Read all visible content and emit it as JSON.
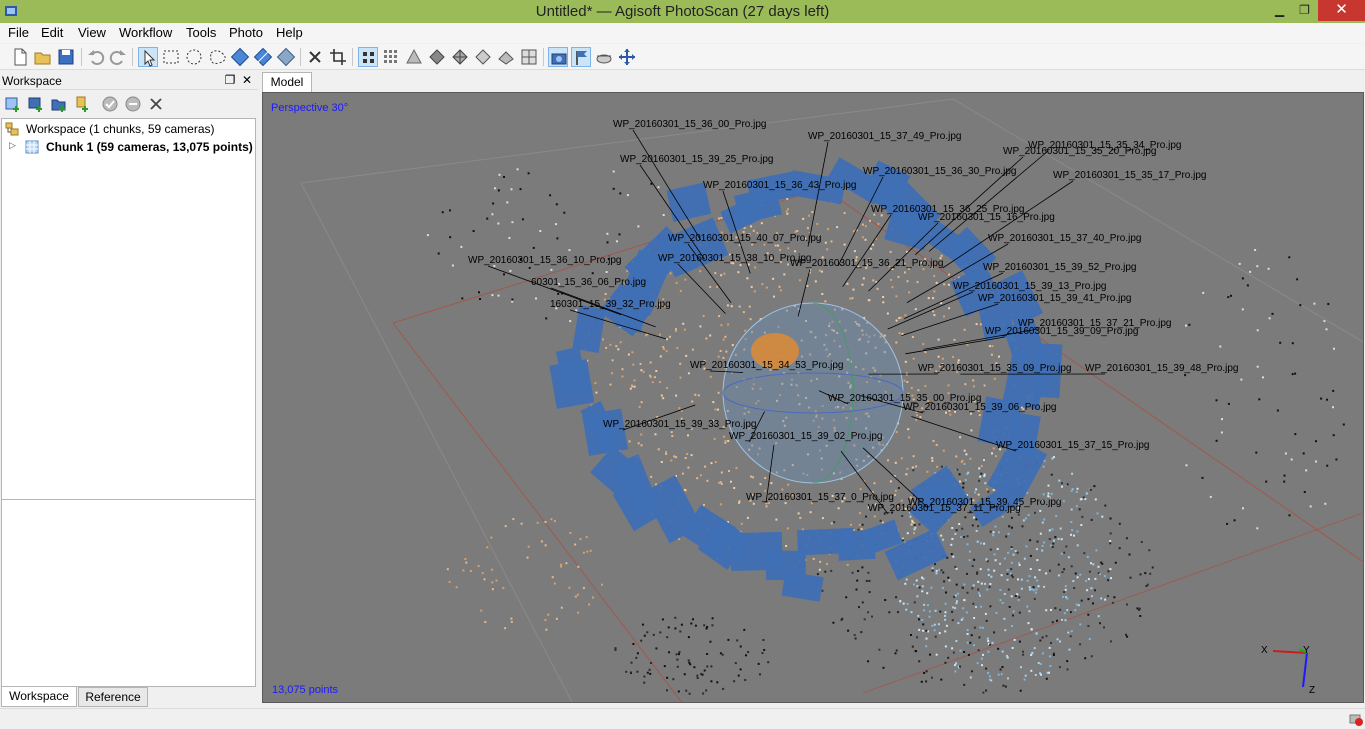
{
  "window": {
    "title": "Untitled* — Agisoft PhotoScan (27 days left)",
    "minimize_glyph": "▁",
    "maximize_glyph": "❐",
    "close_glyph": "✕"
  },
  "menu": [
    "File",
    "Edit",
    "View",
    "Workflow",
    "Tools",
    "Photo",
    "Help"
  ],
  "toolbar_icons": [
    "new-icon",
    "open-icon",
    "save-icon",
    "undo-icon",
    "redo-icon",
    "select-pointer-icon",
    "rectangle-select-icon",
    "circle-select-icon",
    "free-form-select-icon",
    "rotate-object-icon",
    "move-object-icon",
    "scale-object-icon",
    "delete-selection-icon",
    "crop-selection-icon",
    "point-cloud-icon",
    "dense-cloud-icon",
    "shaded-icon",
    "solid-icon",
    "wireframe-icon",
    "textured-icon",
    "tiled-model-icon",
    "show-cameras-icon",
    "show-markers-icon",
    "show-region-icon",
    "reset-view-icon"
  ],
  "workspace": {
    "header": "Workspace",
    "float_glyph": "❐",
    "close_glyph": "✕",
    "toolbar_icons": [
      "add-chunk-icon",
      "add-photos-icon",
      "add-folder-icon",
      "import-icon",
      "enable-icon",
      "disable-icon",
      "remove-icon"
    ],
    "tree": {
      "root_label": "Workspace (1 chunks, 59 cameras)",
      "chunk_label": "Chunk 1 (59 cameras, 13,075 points)",
      "expander_glyph": "▷"
    },
    "tabs": [
      "Workspace",
      "Reference"
    ]
  },
  "model": {
    "tab": "Model",
    "perspective_label": "Perspective 30°",
    "points_label": "13,075 points",
    "axes": {
      "x": "X",
      "y": "Y",
      "z": "Z"
    },
    "colors": {
      "background": "#7b7b7b",
      "camera": "#3f6fb5",
      "label": "#000000",
      "overlay_text": "#1a1aff",
      "region": "#b04a3a"
    },
    "camera_labels": [
      "WP_20160301_15_36_00_Pro.jpg",
      "WP_20160301_15_37_49_Pro.jpg",
      "WP_20160301_15_35_34_Pro.jpg",
      "WP_20160301_15_35_20_Pro.jpg",
      "WP_20160301_15_39_25_Pro.jpg",
      "WP_20160301_15_36_30_Pro.jpg",
      "WP_20160301_15_35_17_Pro.jpg",
      "WP_20160301_15_36_43_Pro.jpg",
      "WP_20160301_15_36_25_Pro.jpg",
      "WP_20160301_15_16_Pro.jpg",
      "WP_20160301_15_40_07_Pro.jpg",
      "WP_20160301_15_37_40_Pro.jpg",
      "WP_20160301_15_38_10_Pro.jpg",
      "WP_20160301_15_36_10_Pro.jpg",
      "WP_20160301_15_36_21_Pro.jpg",
      "WP_20160301_15_39_52_Pro.jpg",
      "60301_15_36_06_Pro.jpg",
      "WP_20160301_15_39_13_Pro.jpg",
      "160301_15_39_32_Pro.jpg",
      "WP_20160301_15_39_41_Pro.jpg",
      "WP_20160301_15_37_21_Pro.jpg",
      "WP_20160301_15_39_09_Pro.jpg",
      "WP_20160301_15_34_53_Pro.jpg",
      "WP_20160301_15_35_09_Pro.jpg",
      "WP_20160301_15_39_48_Pro.jpg",
      "WP_20160301_15_35_00_Pro.jpg",
      "WP_20160301_15_39_06_Pro.jpg",
      "WP_20160301_15_39_33_Pro.jpg",
      "WP_20160301_15_39_02_Pro.jpg",
      "WP_20160301_15_37_15_Pro.jpg",
      "WP_20160301_15_39_45_Pro.jpg",
      "WP_20160301_15_37_11_Pro.jpg",
      "WP_20160301_15_37_0_Pro.jpg"
    ]
  }
}
